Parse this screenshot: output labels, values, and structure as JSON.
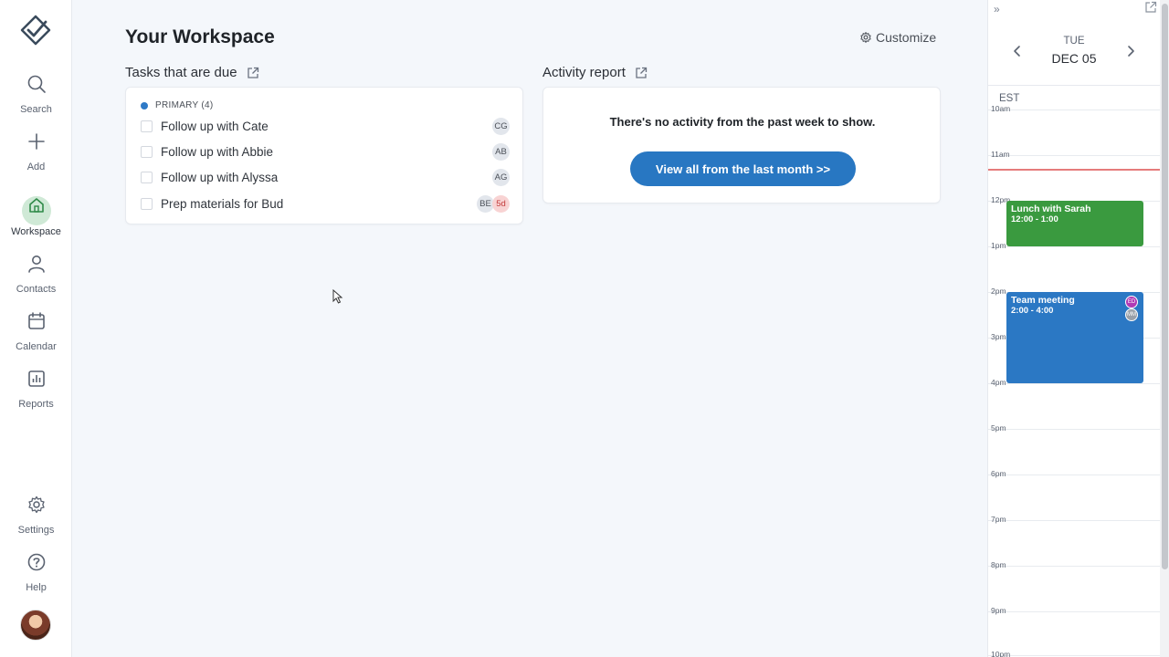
{
  "sidebar": {
    "logo": "checkmark-logo",
    "items": [
      {
        "label": "Search",
        "icon": "search-icon"
      },
      {
        "label": "Add",
        "icon": "plus-icon"
      },
      {
        "label": "Workspace",
        "icon": "home-icon",
        "active": true
      },
      {
        "label": "Contacts",
        "icon": "person-icon"
      },
      {
        "label": "Calendar",
        "icon": "calendar-icon"
      },
      {
        "label": "Reports",
        "icon": "chart-icon"
      },
      {
        "label": "Settings",
        "icon": "gear-icon"
      },
      {
        "label": "Help",
        "icon": "help-icon"
      }
    ]
  },
  "main": {
    "title": "Your Workspace",
    "customize_label": "Customize",
    "tasks": {
      "title": "Tasks that are due",
      "group_label": "PRIMARY (4)",
      "items": [
        {
          "text": "Follow up with Cate",
          "assignee": "CG"
        },
        {
          "text": "Follow up with Abbie",
          "assignee": "AB"
        },
        {
          "text": "Follow up with Alyssa",
          "assignee": "AG"
        },
        {
          "text": "Prep materials for Bud",
          "assignee": "BE",
          "due": "5d"
        }
      ]
    },
    "activity": {
      "title": "Activity report",
      "empty_message": "There's no activity from the past week to show.",
      "button_label": "View all from the last month >>"
    }
  },
  "calendar": {
    "collapse_label": "»",
    "day_of_week": "TUE",
    "date": "DEC 05",
    "timezone": "EST",
    "hours": [
      "10am",
      "11am",
      "12pm",
      "1pm",
      "2pm",
      "3pm",
      "4pm",
      "5pm",
      "6pm",
      "7pm",
      "8pm",
      "9pm",
      "10pm"
    ],
    "events": [
      {
        "title": "Lunch with Sarah",
        "time": "12:00 - 1:00",
        "color": "#3a9a3f"
      },
      {
        "title": "Team meeting",
        "time": "2:00 - 4:00",
        "color": "#2b78c4",
        "attendees": [
          "ED",
          "MM"
        ]
      }
    ]
  },
  "colors": {
    "accent": "#2877c2",
    "active_nav_bg": "#cfe9d6",
    "now_line": "#e57b7b"
  }
}
